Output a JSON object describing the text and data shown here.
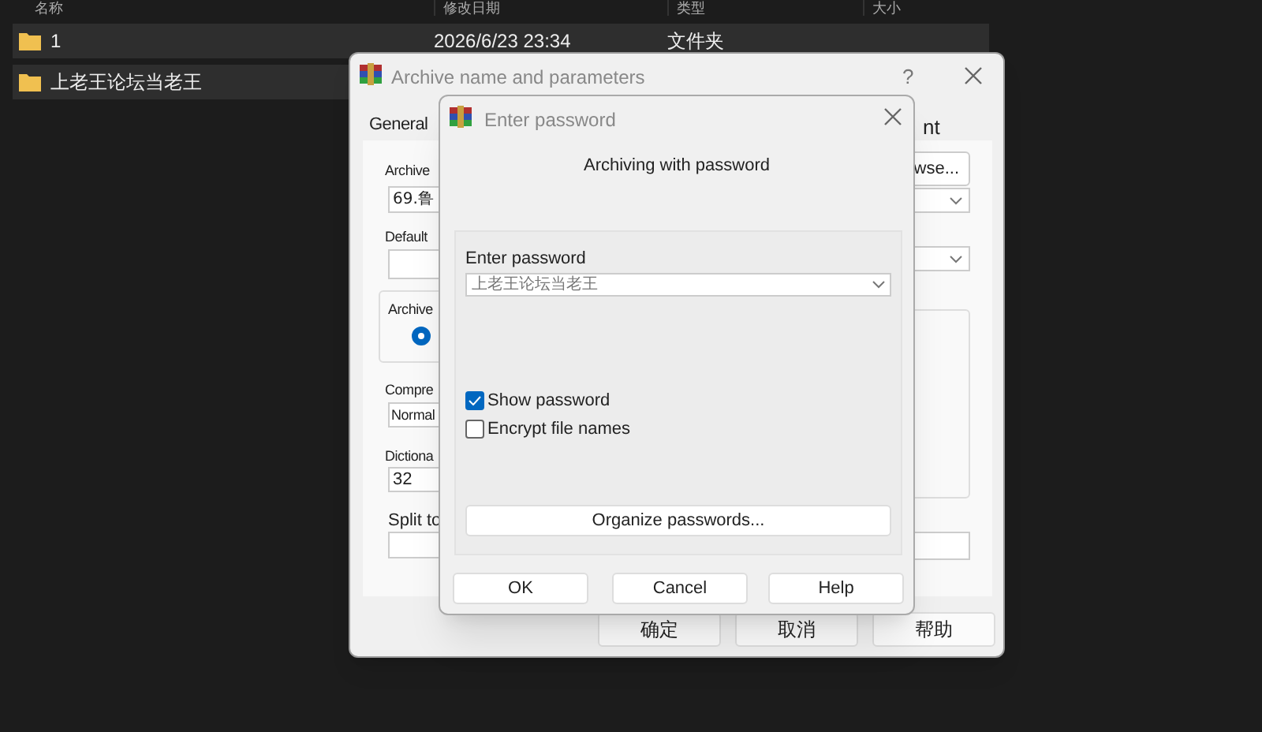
{
  "explorer": {
    "columns": [
      "名称",
      "修改日期",
      "类型",
      "大小"
    ],
    "rows": [
      {
        "name": "1",
        "date": "2026/6/23 23:34",
        "type": "文件夹"
      },
      {
        "name": "上老王论坛当老王"
      }
    ]
  },
  "archive_dialog": {
    "title": "Archive name and parameters",
    "help": "?",
    "tab_left": "General",
    "tab_right": "nt",
    "archive_label": "Archive",
    "archive_value": "69.鲁",
    "browse_button": "wse...",
    "default_label": "Default",
    "group_label": "Archive",
    "radio_selected": true,
    "compression_label": "Compre",
    "compression_value": "Normal",
    "dictionary_label": "Dictiona",
    "dictionary_value": "32",
    "split_label": "Split to",
    "buttons": [
      "确定",
      "取消",
      "帮助"
    ]
  },
  "password_dialog": {
    "title": "Enter password",
    "heading": "Archiving with password",
    "field_label": "Enter password",
    "password_value": "上老王论坛当老王",
    "options": [
      {
        "label": "Show password",
        "checked": true
      },
      {
        "label": "Encrypt file names",
        "checked": false
      }
    ],
    "organize_button": "Organize passwords...",
    "buttons": [
      "OK",
      "Cancel",
      "Help"
    ]
  }
}
